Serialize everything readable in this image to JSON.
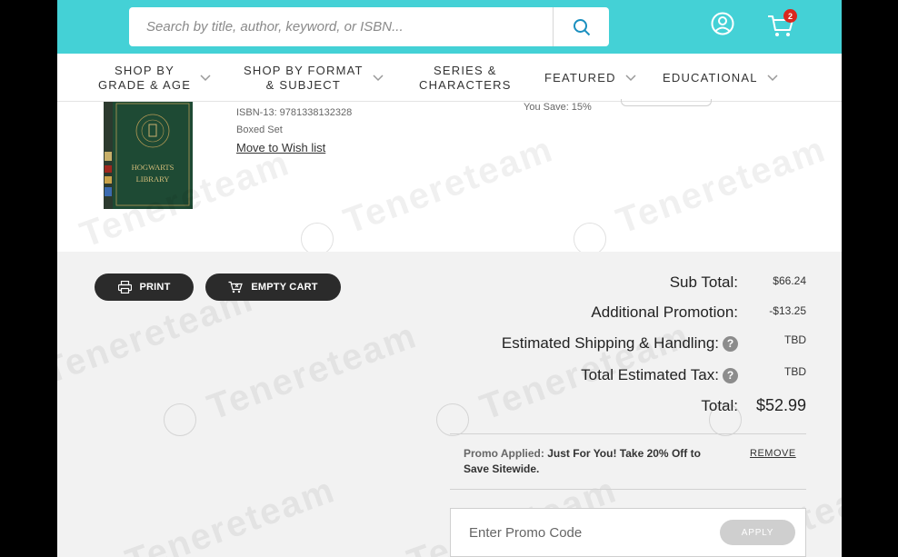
{
  "search": {
    "placeholder": "Search by title, author, keyword, or ISBN..."
  },
  "cart": {
    "count": "2"
  },
  "nav": {
    "items": [
      {
        "line1": "SHOP BY",
        "line2": "GRADE & AGE",
        "has_chevron": true
      },
      {
        "line1": "SHOP BY FORMAT",
        "line2": "& SUBJECT",
        "has_chevron": true
      },
      {
        "line1": "SERIES &",
        "line2": "CHARACTERS",
        "has_chevron": false
      },
      {
        "line1": "FEATURED",
        "line2": "",
        "has_chevron": true
      },
      {
        "line1": "EDUCATIONAL",
        "line2": "",
        "has_chevron": true
      }
    ]
  },
  "product": {
    "isbn": "ISBN-13: 9781338132328",
    "format": "Boxed Set",
    "wishlist_label": "Move to Wish list",
    "you_save": "You Save: 15%",
    "book_cover_text": "Hogwarts Library"
  },
  "actions": {
    "print_label": "PRINT",
    "empty_cart_label": "EMPTY CART"
  },
  "summary": {
    "subtotal_label": "Sub Total:",
    "subtotal_value": "$66.24",
    "promotion_label": "Additional Promotion:",
    "promotion_value": "-$13.25",
    "shipping_label": "Estimated Shipping & Handling:",
    "shipping_value": "TBD",
    "tax_label": "Total Estimated Tax:",
    "tax_value": "TBD",
    "total_label": "Total:",
    "total_value": "$52.99"
  },
  "promo": {
    "applied_prefix": "Promo Applied:",
    "applied_text": "Just For You! Take 20% Off to Save Sitewide.",
    "remove_label": "REMOVE",
    "input_placeholder": "Enter Promo Code",
    "apply_label": "APPLY"
  },
  "watermark": {
    "text": "Tenereteam"
  },
  "colors": {
    "header": "#44d1d6",
    "badge": "#d9271e",
    "dark_button": "#2b2b2b",
    "summary_bg": "#f2f2f2"
  }
}
